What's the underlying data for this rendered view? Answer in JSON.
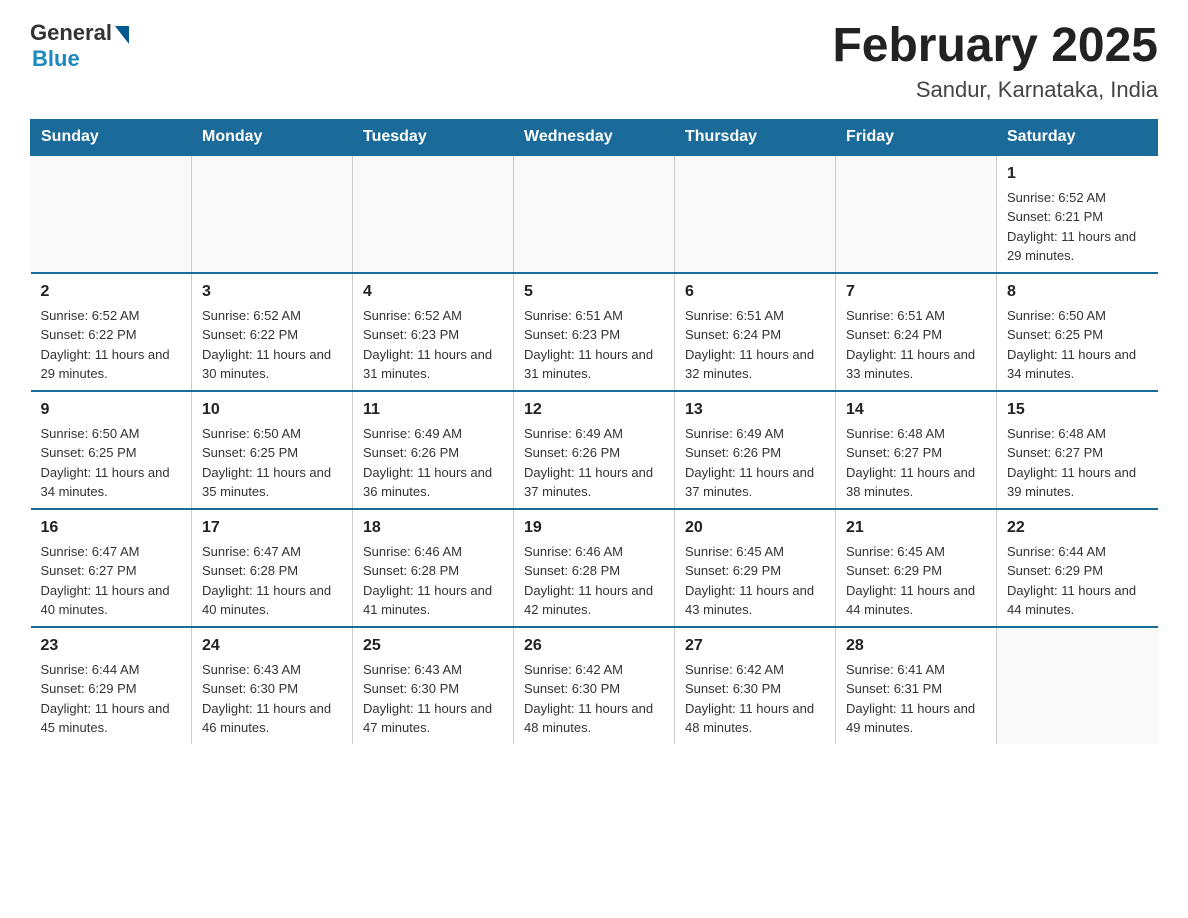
{
  "header": {
    "logo_general": "General",
    "logo_blue": "Blue",
    "title": "February 2025",
    "subtitle": "Sandur, Karnataka, India"
  },
  "weekdays": [
    "Sunday",
    "Monday",
    "Tuesday",
    "Wednesday",
    "Thursday",
    "Friday",
    "Saturday"
  ],
  "weeks": [
    [
      {
        "day": "",
        "info": ""
      },
      {
        "day": "",
        "info": ""
      },
      {
        "day": "",
        "info": ""
      },
      {
        "day": "",
        "info": ""
      },
      {
        "day": "",
        "info": ""
      },
      {
        "day": "",
        "info": ""
      },
      {
        "day": "1",
        "info": "Sunrise: 6:52 AM\nSunset: 6:21 PM\nDaylight: 11 hours and 29 minutes."
      }
    ],
    [
      {
        "day": "2",
        "info": "Sunrise: 6:52 AM\nSunset: 6:22 PM\nDaylight: 11 hours and 29 minutes."
      },
      {
        "day": "3",
        "info": "Sunrise: 6:52 AM\nSunset: 6:22 PM\nDaylight: 11 hours and 30 minutes."
      },
      {
        "day": "4",
        "info": "Sunrise: 6:52 AM\nSunset: 6:23 PM\nDaylight: 11 hours and 31 minutes."
      },
      {
        "day": "5",
        "info": "Sunrise: 6:51 AM\nSunset: 6:23 PM\nDaylight: 11 hours and 31 minutes."
      },
      {
        "day": "6",
        "info": "Sunrise: 6:51 AM\nSunset: 6:24 PM\nDaylight: 11 hours and 32 minutes."
      },
      {
        "day": "7",
        "info": "Sunrise: 6:51 AM\nSunset: 6:24 PM\nDaylight: 11 hours and 33 minutes."
      },
      {
        "day": "8",
        "info": "Sunrise: 6:50 AM\nSunset: 6:25 PM\nDaylight: 11 hours and 34 minutes."
      }
    ],
    [
      {
        "day": "9",
        "info": "Sunrise: 6:50 AM\nSunset: 6:25 PM\nDaylight: 11 hours and 34 minutes."
      },
      {
        "day": "10",
        "info": "Sunrise: 6:50 AM\nSunset: 6:25 PM\nDaylight: 11 hours and 35 minutes."
      },
      {
        "day": "11",
        "info": "Sunrise: 6:49 AM\nSunset: 6:26 PM\nDaylight: 11 hours and 36 minutes."
      },
      {
        "day": "12",
        "info": "Sunrise: 6:49 AM\nSunset: 6:26 PM\nDaylight: 11 hours and 37 minutes."
      },
      {
        "day": "13",
        "info": "Sunrise: 6:49 AM\nSunset: 6:26 PM\nDaylight: 11 hours and 37 minutes."
      },
      {
        "day": "14",
        "info": "Sunrise: 6:48 AM\nSunset: 6:27 PM\nDaylight: 11 hours and 38 minutes."
      },
      {
        "day": "15",
        "info": "Sunrise: 6:48 AM\nSunset: 6:27 PM\nDaylight: 11 hours and 39 minutes."
      }
    ],
    [
      {
        "day": "16",
        "info": "Sunrise: 6:47 AM\nSunset: 6:27 PM\nDaylight: 11 hours and 40 minutes."
      },
      {
        "day": "17",
        "info": "Sunrise: 6:47 AM\nSunset: 6:28 PM\nDaylight: 11 hours and 40 minutes."
      },
      {
        "day": "18",
        "info": "Sunrise: 6:46 AM\nSunset: 6:28 PM\nDaylight: 11 hours and 41 minutes."
      },
      {
        "day": "19",
        "info": "Sunrise: 6:46 AM\nSunset: 6:28 PM\nDaylight: 11 hours and 42 minutes."
      },
      {
        "day": "20",
        "info": "Sunrise: 6:45 AM\nSunset: 6:29 PM\nDaylight: 11 hours and 43 minutes."
      },
      {
        "day": "21",
        "info": "Sunrise: 6:45 AM\nSunset: 6:29 PM\nDaylight: 11 hours and 44 minutes."
      },
      {
        "day": "22",
        "info": "Sunrise: 6:44 AM\nSunset: 6:29 PM\nDaylight: 11 hours and 44 minutes."
      }
    ],
    [
      {
        "day": "23",
        "info": "Sunrise: 6:44 AM\nSunset: 6:29 PM\nDaylight: 11 hours and 45 minutes."
      },
      {
        "day": "24",
        "info": "Sunrise: 6:43 AM\nSunset: 6:30 PM\nDaylight: 11 hours and 46 minutes."
      },
      {
        "day": "25",
        "info": "Sunrise: 6:43 AM\nSunset: 6:30 PM\nDaylight: 11 hours and 47 minutes."
      },
      {
        "day": "26",
        "info": "Sunrise: 6:42 AM\nSunset: 6:30 PM\nDaylight: 11 hours and 48 minutes."
      },
      {
        "day": "27",
        "info": "Sunrise: 6:42 AM\nSunset: 6:30 PM\nDaylight: 11 hours and 48 minutes."
      },
      {
        "day": "28",
        "info": "Sunrise: 6:41 AM\nSunset: 6:31 PM\nDaylight: 11 hours and 49 minutes."
      },
      {
        "day": "",
        "info": ""
      }
    ]
  ]
}
